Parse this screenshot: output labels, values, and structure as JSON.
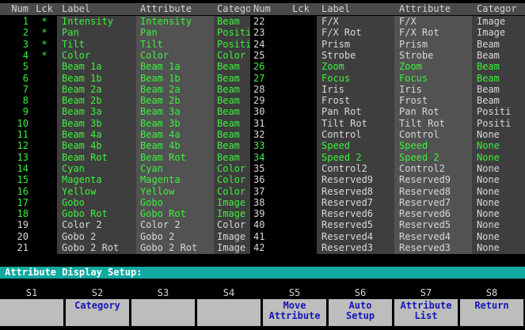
{
  "headers": {
    "num": "Num",
    "lck": "Lck",
    "label": "Label",
    "attribute": "Attribute",
    "category": "Category",
    "num2": "Num",
    "lck2": "Lck",
    "label2": "Label",
    "attribute2": "Attribute",
    "category2": "Categor"
  },
  "left_rows": [
    {
      "num": "1",
      "lck": "*",
      "label": "Intensity",
      "attr": "Intensity",
      "cat": "Beam",
      "color": "green"
    },
    {
      "num": "2",
      "lck": "*",
      "label": "Pan",
      "attr": "Pan",
      "cat": "Positi",
      "color": "green"
    },
    {
      "num": "3",
      "lck": "*",
      "label": "Tilt",
      "attr": "Tilt",
      "cat": "Positi",
      "color": "green"
    },
    {
      "num": "4",
      "lck": "*",
      "label": "Color",
      "attr": "Color",
      "cat": "Color",
      "color": "green"
    },
    {
      "num": "5",
      "lck": "",
      "label": "Beam 1a",
      "attr": "Beam 1a",
      "cat": "Beam",
      "color": "green"
    },
    {
      "num": "6",
      "lck": "",
      "label": "Beam 1b",
      "attr": "Beam 1b",
      "cat": "Beam",
      "color": "green"
    },
    {
      "num": "7",
      "lck": "",
      "label": "Beam 2a",
      "attr": "Beam 2a",
      "cat": "Beam",
      "color": "green"
    },
    {
      "num": "8",
      "lck": "",
      "label": "Beam 2b",
      "attr": "Beam 2b",
      "cat": "Beam",
      "color": "green"
    },
    {
      "num": "9",
      "lck": "",
      "label": "Beam 3a",
      "attr": "Beam 3a",
      "cat": "Beam",
      "color": "green"
    },
    {
      "num": "10",
      "lck": "",
      "label": "Beam 3b",
      "attr": "Beam 3b",
      "cat": "Beam",
      "color": "green"
    },
    {
      "num": "11",
      "lck": "",
      "label": "Beam 4a",
      "attr": "Beam 4a",
      "cat": "Beam",
      "color": "green"
    },
    {
      "num": "12",
      "lck": "",
      "label": "Beam 4b",
      "attr": "Beam 4b",
      "cat": "Beam",
      "color": "green"
    },
    {
      "num": "13",
      "lck": "",
      "label": "Beam Rot",
      "attr": "Beam Rot",
      "cat": "Beam",
      "color": "green"
    },
    {
      "num": "14",
      "lck": "",
      "label": "Cyan",
      "attr": "Cyan",
      "cat": "Color",
      "color": "green"
    },
    {
      "num": "15",
      "lck": "",
      "label": "Magenta",
      "attr": "Magenta",
      "cat": "Color",
      "color": "green"
    },
    {
      "num": "16",
      "lck": "",
      "label": "Yellow",
      "attr": "Yellow",
      "cat": "Color",
      "color": "green"
    },
    {
      "num": "17",
      "lck": "",
      "label": "Gobo",
      "attr": "Gobo",
      "cat": "Image",
      "color": "green"
    },
    {
      "num": "18",
      "lck": "",
      "label": "Gobo Rot",
      "attr": "Gobo Rot",
      "cat": "Image",
      "color": "green"
    },
    {
      "num": "19",
      "lck": "",
      "label": "Color 2",
      "attr": "Color 2",
      "cat": "Color",
      "color": "grey"
    },
    {
      "num": "20",
      "lck": "",
      "label": "Gobo 2",
      "attr": "Gobo 2",
      "cat": "Image",
      "color": "grey"
    },
    {
      "num": "21",
      "lck": "",
      "label": "Gobo 2 Rot",
      "attr": "Gobo 2 Rot",
      "cat": "Image",
      "color": "grey"
    }
  ],
  "right_rows": [
    {
      "num": "22",
      "lck": "",
      "label": "F/X",
      "attr": "F/X",
      "cat": "Image",
      "color": "grey"
    },
    {
      "num": "23",
      "lck": "",
      "label": "F/X Rot",
      "attr": "F/X Rot",
      "cat": "Image",
      "color": "grey"
    },
    {
      "num": "24",
      "lck": "",
      "label": "Prism",
      "attr": "Prism",
      "cat": "Beam",
      "color": "grey"
    },
    {
      "num": "25",
      "lck": "",
      "label": "Strobe",
      "attr": "Strobe",
      "cat": "Beam",
      "color": "grey"
    },
    {
      "num": "26",
      "lck": "",
      "label": "Zoom",
      "attr": "Zoom",
      "cat": "Beam",
      "color": "green"
    },
    {
      "num": "27",
      "lck": "",
      "label": "Focus",
      "attr": "Focus",
      "cat": "Beam",
      "color": "green"
    },
    {
      "num": "28",
      "lck": "",
      "label": "Iris",
      "attr": "Iris",
      "cat": "Beam",
      "color": "grey"
    },
    {
      "num": "29",
      "lck": "",
      "label": "Frost",
      "attr": "Frost",
      "cat": "Beam",
      "color": "grey"
    },
    {
      "num": "30",
      "lck": "",
      "label": "Pan Rot",
      "attr": "Pan Rot",
      "cat": "Positi",
      "color": "grey"
    },
    {
      "num": "31",
      "lck": "",
      "label": "Tilt Rot",
      "attr": "Tilt Rot",
      "cat": "Positi",
      "color": "grey"
    },
    {
      "num": "32",
      "lck": "",
      "label": "Control",
      "attr": "Control",
      "cat": "None",
      "color": "grey"
    },
    {
      "num": "33",
      "lck": "",
      "label": "Speed",
      "attr": "Speed",
      "cat": "None",
      "color": "green"
    },
    {
      "num": "34",
      "lck": "",
      "label": "Speed 2",
      "attr": "Speed 2",
      "cat": "None",
      "color": "green"
    },
    {
      "num": "35",
      "lck": "",
      "label": "Control2",
      "attr": "Control2",
      "cat": "None",
      "color": "grey"
    },
    {
      "num": "36",
      "lck": "",
      "label": "Reserved9",
      "attr": "Reserved9",
      "cat": "None",
      "color": "grey"
    },
    {
      "num": "37",
      "lck": "",
      "label": "Reserved8",
      "attr": "Reserved8",
      "cat": "None",
      "color": "grey"
    },
    {
      "num": "38",
      "lck": "",
      "label": "Reserved7",
      "attr": "Reserved7",
      "cat": "None",
      "color": "grey"
    },
    {
      "num": "39",
      "lck": "",
      "label": "Reserved6",
      "attr": "Reserved6",
      "cat": "None",
      "color": "grey"
    },
    {
      "num": "40",
      "lck": "",
      "label": "Reserved5",
      "attr": "Reserved5",
      "cat": "None",
      "color": "grey"
    },
    {
      "num": "41",
      "lck": "",
      "label": "Reserved4",
      "attr": "Reserved4",
      "cat": "None",
      "color": "grey"
    },
    {
      "num": "42",
      "lck": "",
      "label": "Reserved3",
      "attr": "Reserved3",
      "cat": "None",
      "color": "grey"
    }
  ],
  "status": "Attribute Display Setup:",
  "softkeys": [
    {
      "key": "S1",
      "line1": "",
      "line2": ""
    },
    {
      "key": "S2",
      "line1": "Category",
      "line2": ""
    },
    {
      "key": "S3",
      "line1": "",
      "line2": ""
    },
    {
      "key": "S4",
      "line1": "",
      "line2": ""
    },
    {
      "key": "S5",
      "line1": "Move",
      "line2": "Attribute"
    },
    {
      "key": "S6",
      "line1": "Auto",
      "line2": "Setup"
    },
    {
      "key": "S7",
      "line1": "Attribute",
      "line2": "List"
    },
    {
      "key": "S8",
      "line1": "Return",
      "line2": ""
    }
  ],
  "colors": {
    "green": "#3cf03c",
    "grey": "#d8d8d8",
    "status_bg": "#10a8a0",
    "button_bg": "#bdbdbd",
    "button_text": "#1616b8"
  }
}
